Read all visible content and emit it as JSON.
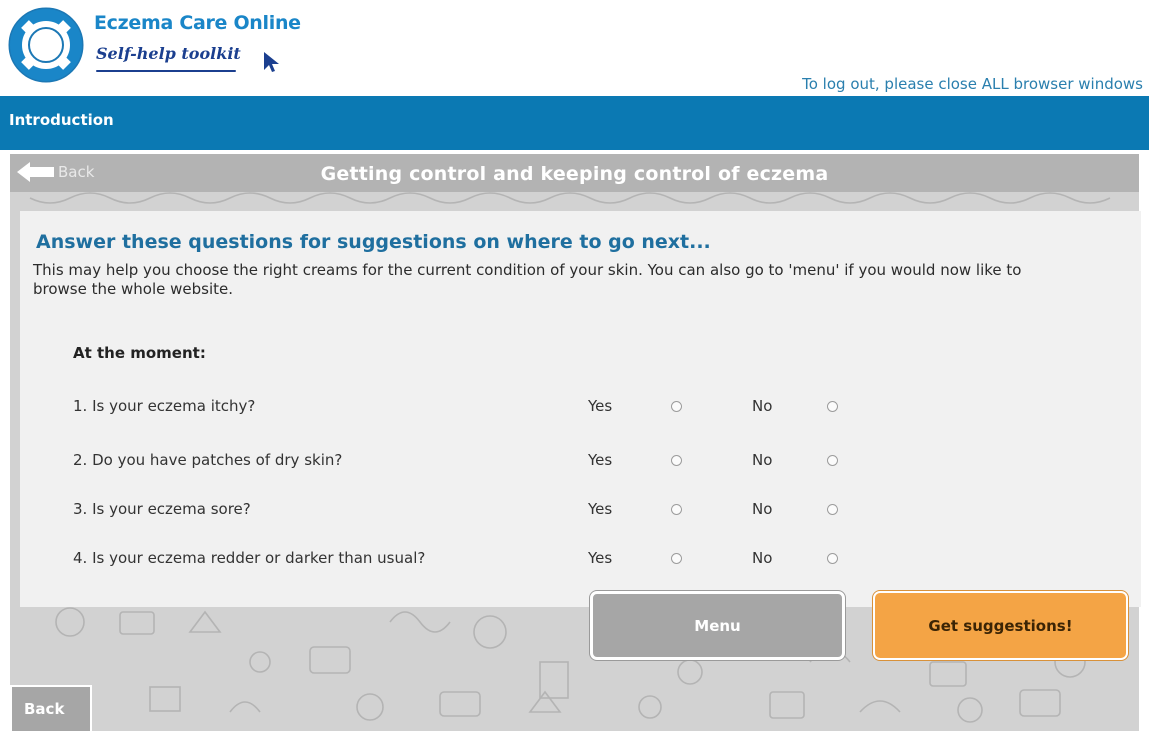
{
  "header": {
    "brand_line1": "Eczema Care Online",
    "brand_line2": "Self-help toolkit",
    "logout_text": "To log out, please close ALL browser windows"
  },
  "nav": {
    "title": "Introduction"
  },
  "subbar": {
    "back_label": "Back",
    "title": "Getting control and keeping control of eczema"
  },
  "main": {
    "heading": "Answer these questions for suggestions on where to go next...",
    "intro": "This may help you choose the right creams for the current condition of your skin. You can also go to 'menu' if you would now like to browse the whole website.",
    "moment_label": "At the moment:",
    "yes_label": "Yes",
    "no_label": "No",
    "questions": [
      {
        "text": "1. Is your eczema itchy?"
      },
      {
        "text": "2. Do you have patches of dry skin?"
      },
      {
        "text": "3. Is your eczema sore?"
      },
      {
        "text": "4. Is your eczema redder or darker than usual?"
      }
    ]
  },
  "buttons": {
    "menu_label": "Menu",
    "suggest_label": "Get suggestions!",
    "back_label": "Back"
  },
  "icons": {
    "logo": "lifebuoy-icon",
    "cursor": "cursor-arrow-icon",
    "back": "back-arrow-icon"
  },
  "colors": {
    "brand_blue": "#1a86c8",
    "nav_blue": "#0b79b3",
    "heading_blue": "#1f6f9f",
    "subbar_gray": "#b3b3b3",
    "button_gray": "#a6a6a6",
    "button_orange": "#f4a445"
  }
}
